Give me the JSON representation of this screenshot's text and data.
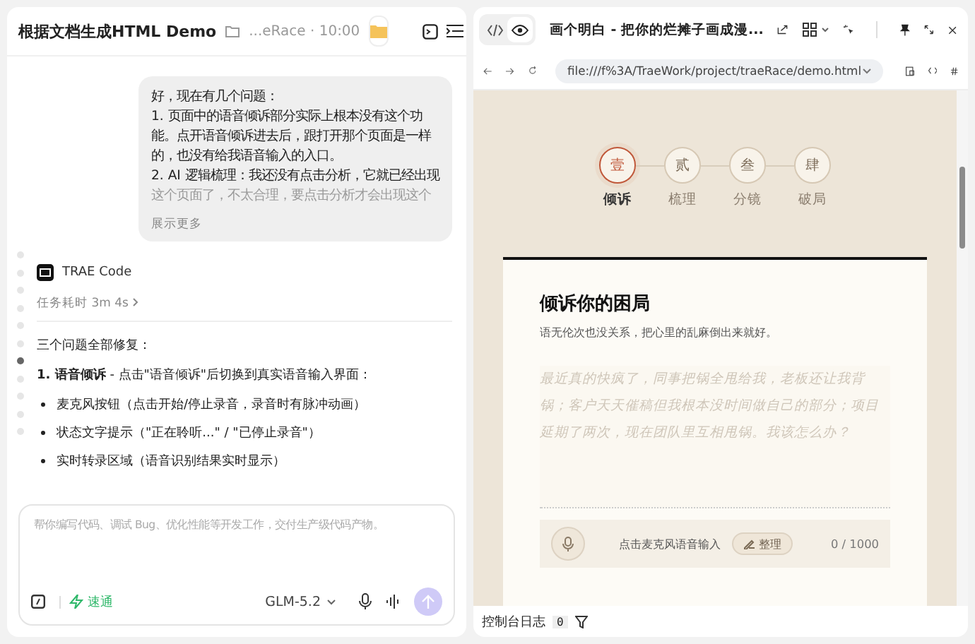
{
  "chat": {
    "title": "根据文档生成HTML Demo",
    "path": "...eRace · 10:00",
    "user_message": {
      "lines": [
        "好，现在有几个问题：",
        "1. 页面中的语音倾诉部分实际上根本没有这个功能。点开语音倾诉进去后，跟打开那个页面是一样的，也没有给我语音输入的入口。",
        "2. AI 逻辑梳理：我还没有点击分析，它就已经出现",
        "这个页面了，不太合理，要点击分析才会出现这个"
      ],
      "show_more": "展示更多"
    },
    "agent": {
      "name": "TRAE Code",
      "duration": "任务耗时 3m 4s",
      "intro": "三个问题全部修复：",
      "point": "**1. 语音倾诉** - 点击\"语音倾诉\"后切换到真实语音输入界面：",
      "bullets": [
        "麦克风按钮（点击开始/停止录音，录音时有脉冲动画）",
        "状态文字提示（\"正在聆听...\" / \"已停止录音\"）",
        "实时转录区域（语音识别结果实时显示）"
      ]
    },
    "composer": {
      "placeholder": "帮你编写代码、调试 Bug、优化性能等开发工作，交付生产级代码产物。",
      "mode": "速通",
      "model": "GLM-5.2"
    }
  },
  "preview": {
    "title": "画个明白 - 把你的烂摊子画成漫...",
    "view_tabs": [
      {
        "kind": "code",
        "selected": false
      },
      {
        "kind": "preview",
        "selected": true
      }
    ],
    "url": "file:///f%3A/TraeWork/project/traeRace/demo.html",
    "steps": [
      {
        "numeral": "壹",
        "label": "倾诉",
        "selected": true
      },
      {
        "numeral": "贰",
        "label": "梳理",
        "selected": false
      },
      {
        "numeral": "叁",
        "label": "分镜",
        "selected": false
      },
      {
        "numeral": "肆",
        "label": "破局",
        "selected": false
      }
    ],
    "card": {
      "title": "倾诉你的困局",
      "subtitle": "语无伦次也没关系，把心里的乱麻倒出来就好。",
      "placeholder": "最近真的快疯了，同事把锅全甩给我，老板还让我背锅；客户天天催稿但我根本没时间做自己的部分；项目延期了两次，现在团队里互相甩锅。我该怎么办？",
      "voice_hint": "点击麦克风语音输入",
      "organize": "整理",
      "count": "0 / 1000"
    },
    "console": {
      "label": "控制台日志",
      "count": "0"
    }
  }
}
